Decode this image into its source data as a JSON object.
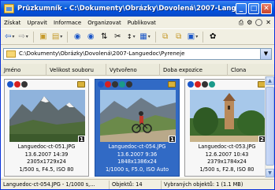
{
  "window": {
    "title": "Průzkumník - C:\\Dokumenty\\Obrázky\\Dovolená\\2007-Langu...",
    "controls": {
      "minimize": "_",
      "maximize": "□",
      "close": "✕"
    }
  },
  "menu": {
    "items": [
      "Získat",
      "Upravit",
      "Informace",
      "Organizovat",
      "Publikovat"
    ],
    "right_icons": [
      "print-icon",
      "settings-icon",
      "help-icon",
      "close-icon"
    ]
  },
  "toolbar": {
    "buttons": [
      "back-icon",
      "forward-icon",
      "folder-up-icon",
      "folder-view-icon",
      "rotate-left-icon",
      "rotate-right-icon",
      "flip-icon",
      "cut-icon",
      "sort-icon",
      "view-mode-icon",
      "rename-icon",
      "copy-icon",
      "slideshow-icon"
    ]
  },
  "address": {
    "path": "C:\\Dokumenty\\Obrázky\\Dovolená\\2007-Languedoc\\Pyreneje"
  },
  "columns": {
    "headers": [
      "Jméno",
      "Velikost souboru",
      "Vytvořeno",
      "Doba expozice",
      "Clona"
    ]
  },
  "thumbnails": [
    {
      "filename": "Languedoc-ct-051.JPG",
      "date": "13.6.2007 14:39",
      "dimensions": "2305x1729x24",
      "exposure": "1/500 s, F4.5, ISO 80",
      "number": "1",
      "selected": false
    },
    {
      "filename": "Languedoc-ct-054.JPG",
      "date": "13.6.2007 9:36",
      "dimensions": "1848x1386x24",
      "exposure": "1/1000 s, F5.0, ISO Auto",
      "number": "1",
      "selected": true
    },
    {
      "filename": "Languedoc-ct-053.JPG",
      "date": "12.6.2007 10:43",
      "dimensions": "2379x1784x24",
      "exposure": "1/500 s, F2.8, ISO 80",
      "number": "2",
      "selected": false
    }
  ],
  "status": {
    "selected_file": "Languedoc-ct-054.JPG - 1/1000 s,...",
    "object_count": "Objektů: 14",
    "selected_count": "Vybraných objektů: 1 (1.1 MB)"
  },
  "colors": {
    "titlebar": "#0a5fd9",
    "selection": "#316ac5",
    "chrome": "#f1efe2"
  }
}
